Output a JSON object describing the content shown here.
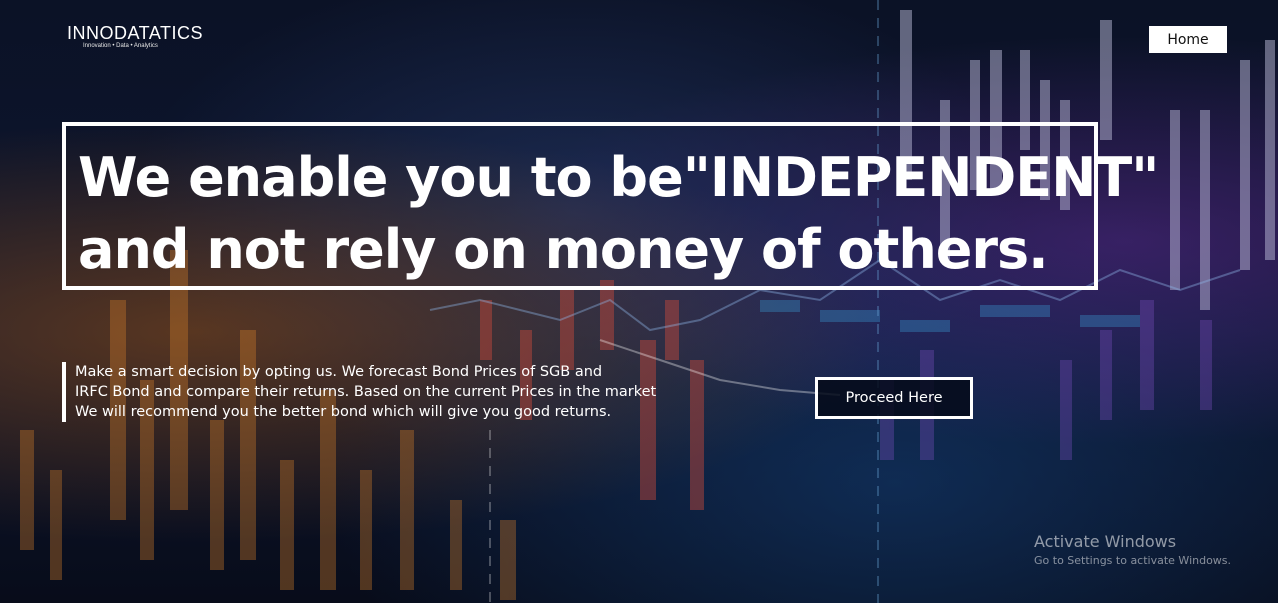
{
  "brand": {
    "name": "INNODATATICS",
    "tagline": "Innovation • Data • Analytics"
  },
  "nav": {
    "home_label": "Home"
  },
  "hero": {
    "headline_line1": "We enable you to be\"INDEPENDENT\"",
    "headline_line2": "and not rely on money of others."
  },
  "description": {
    "line1": "Make a smart decision by opting us. We forecast Bond Prices of SGB and",
    "line2": "IRFC Bond and compare their returns. Based on the current Prices in the market",
    "line3": "We will recommend you the better bond which will give you good returns."
  },
  "cta": {
    "proceed_label": "Proceed Here"
  },
  "watermark": {
    "title": "Activate Windows",
    "subtitle": "Go to Settings to activate Windows."
  },
  "colors": {
    "background": "#0a1022",
    "text": "#ffffff",
    "home_button_bg": "#ffffff",
    "accent_orange": "#d9822b",
    "accent_purple": "#7a4fc0",
    "accent_blue": "#3a7bd5"
  },
  "icons": {
    "logo_mark": "gear-icon"
  }
}
